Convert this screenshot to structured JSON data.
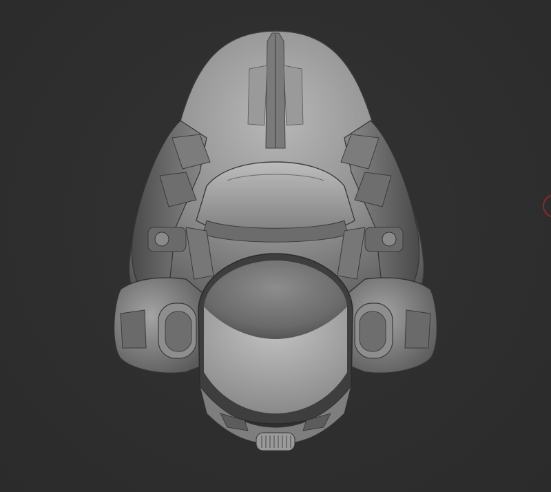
{
  "scene": {
    "subject": "helmet",
    "background_color": "#2f2f2f",
    "material_color": "#8c8c8c",
    "cursor_ring_color": "#8a2a2a"
  }
}
